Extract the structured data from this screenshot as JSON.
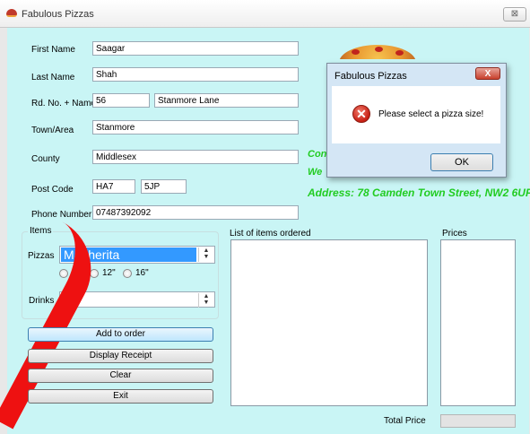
{
  "window": {
    "title": "Fabulous Pizzas",
    "close_label": "⊠"
  },
  "form": {
    "first_name": {
      "label": "First Name",
      "value": "Saagar"
    },
    "last_name": {
      "label": "Last Name",
      "value": "Shah"
    },
    "road": {
      "label": "Rd. No. + Name",
      "number": "56",
      "name": "Stanmore Lane"
    },
    "town": {
      "label": "Town/Area",
      "value": "Stanmore"
    },
    "county": {
      "label": "County",
      "value": "Middlesex"
    },
    "postcode": {
      "label": "Post Code",
      "part1": "HA7",
      "part2": "5JP"
    },
    "phone": {
      "label": "Phone Number",
      "value": "07487392092"
    }
  },
  "items": {
    "group_label": "Items",
    "pizza_label": "Pizzas",
    "pizza_selected": "Magherita",
    "sizes": [
      "8\"",
      "12\"",
      "16\""
    ],
    "drinks_label": "Drinks",
    "drinks_value": ""
  },
  "buttons": {
    "add": "Add to order",
    "receipt": "Display Receipt",
    "clear": "Clear",
    "exit": "Exit"
  },
  "orders": {
    "list_label": "List of items ordered",
    "prices_label": "Prices"
  },
  "promo": {
    "line1": "Con",
    "line2": "We",
    "address": "Address: 78 Camden Town Street, NW2 6UP"
  },
  "totals": {
    "label": "Total Price",
    "value": ""
  },
  "dialog": {
    "title": "Fabulous Pizzas",
    "close_label": "X",
    "icon": "error-icon",
    "icon_glyph": "✕",
    "message": "Please select a pizza size!",
    "ok": "OK"
  },
  "colors": {
    "client_bg": "#c9f5f5",
    "promo_green": "#22cc22",
    "selection_blue": "#3399ff",
    "stroke_red": "#ee1111"
  }
}
